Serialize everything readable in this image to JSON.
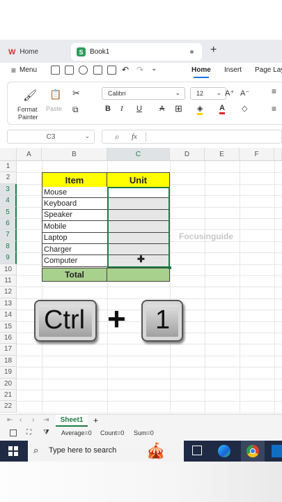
{
  "tabs": {
    "home_label": "Home",
    "book_label": "Book1",
    "logo": "W",
    "sheet_icon": "S"
  },
  "menubar": {
    "menu_label": "Menu",
    "home": "Home",
    "insert": "Insert",
    "page_layout": "Page Lay"
  },
  "ribbon": {
    "format_painter": [
      "Format",
      "Painter"
    ],
    "paste": "Paste",
    "font": "Calibri",
    "size": "12",
    "grow": "A⁺",
    "shrink": "A⁻"
  },
  "formula_bar": {
    "name_box": "C3",
    "fx": "fx"
  },
  "columns": [
    "A",
    "B",
    "C",
    "D",
    "E",
    "F"
  ],
  "rows": [
    "1",
    "2",
    "3",
    "4",
    "5",
    "6",
    "7",
    "8",
    "9",
    "10",
    "11",
    "12",
    "13",
    "14",
    "15",
    "16",
    "17",
    "18",
    "19",
    "20",
    "21",
    "22"
  ],
  "table": {
    "header_item": "Item",
    "header_unit": "Unit",
    "items": [
      "Mouse",
      "Keyboard",
      "Speaker",
      "Mobile",
      "Laptop",
      "Charger",
      "Computer"
    ],
    "total_label": "Total"
  },
  "watermark": "Focusinguide",
  "overlay": {
    "key1": "Ctrl",
    "plus": "+",
    "key2": "1"
  },
  "sheetbar": {
    "sheet_name": "Sheet1",
    "add": "+"
  },
  "statusbar": {
    "average": "Average=0",
    "count": "Count=0",
    "sum": "Sum=0"
  },
  "taskbar": {
    "search_placeholder": "Type here to search"
  },
  "colors": {
    "yellow": "#ffff00",
    "green": "#a9d18e",
    "selection": "#1e7b45",
    "accent": "#1a73e8"
  }
}
